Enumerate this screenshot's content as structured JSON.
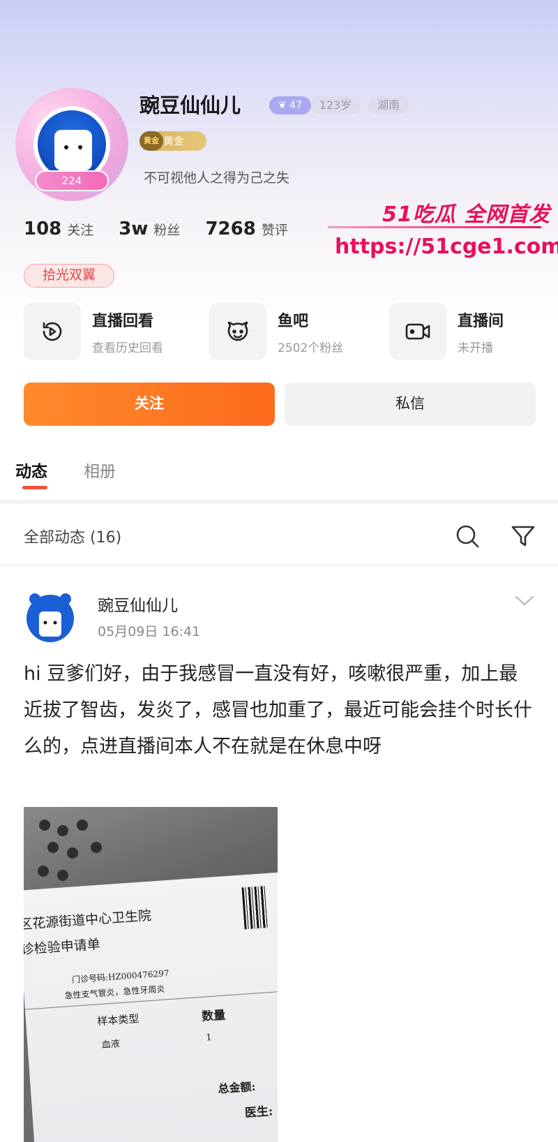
{
  "profile": {
    "username": "豌豆仙仙儿",
    "avatar_level": "224",
    "level_badge": "47",
    "age": "123岁",
    "region": "湖南",
    "rank_medal": "黄金",
    "rank_label": "黄金",
    "signature": "不可视他人之得为己之失",
    "medal_tag": "拾光双翼"
  },
  "stats": [
    {
      "value": "108",
      "label": "关注"
    },
    {
      "value": "3w",
      "label": "粉丝"
    },
    {
      "value": "7268",
      "label": "赞评"
    }
  ],
  "watermark": {
    "title": "51吃瓜 全网首发",
    "url": "https://51cge1.com"
  },
  "features": [
    {
      "title": "直播回看",
      "subtitle": "查看历史回看",
      "icon": "replay-icon"
    },
    {
      "title": "鱼吧",
      "subtitle": "2502个粉丝",
      "icon": "fish-bar-icon"
    },
    {
      "title": "直播间",
      "subtitle": "未开播",
      "icon": "video-camera-icon"
    }
  ],
  "actions": {
    "follow": "关注",
    "message": "私信"
  },
  "tabs": [
    {
      "label": "动态",
      "active": true
    },
    {
      "label": "相册",
      "active": false
    }
  ],
  "feed": {
    "header": "全部动态 (16)"
  },
  "post": {
    "author": "豌豆仙仙儿",
    "time": "05月09日 16:41",
    "text": "hi 豆爹们好，由于我感冒一直没有好，咳嗽很严重，加上最近拔了智齿，发炎了，感冒也加重了，最近可能会挂个时长什么的，点进直播间本人不在就是在休息中呀",
    "photo": {
      "hospital": "区花源街道中心卫生院",
      "form_title": "诊检验申请单",
      "clinic_no": "门诊号码:HZ000476297",
      "diagnosis": "急性支气管炎，急性牙周炎",
      "col_sample": "样本类型",
      "col_qty": "数量",
      "sample": "血液",
      "qty": "1",
      "total": "总金额:",
      "doctor": "医生:"
    }
  },
  "colors": {
    "accent": "#fc6a1c",
    "watermark": "#e8105a",
    "tab_underline": "#f0513a"
  }
}
